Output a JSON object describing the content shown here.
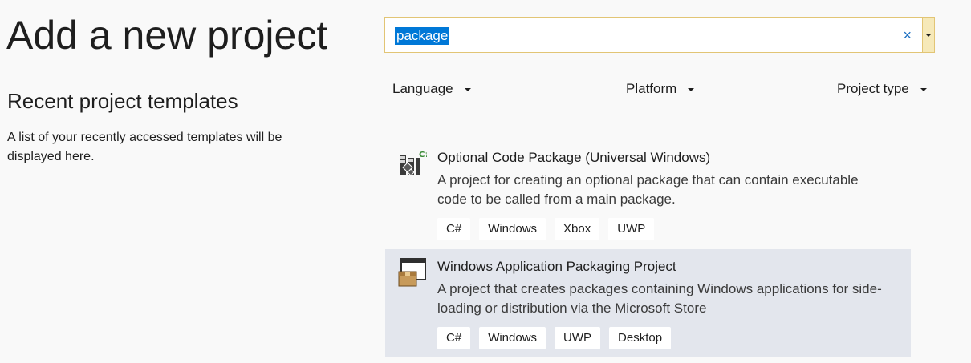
{
  "page": {
    "title": "Add a new project"
  },
  "recent": {
    "heading": "Recent project templates",
    "description": "A list of your recently accessed templates will be displayed here."
  },
  "search": {
    "value": "package",
    "clear_label": "×"
  },
  "filters": [
    {
      "label": "Language"
    },
    {
      "label": "Platform"
    },
    {
      "label": "Project type"
    }
  ],
  "results": [
    {
      "title": "Optional Code Package (Universal Windows)",
      "description": "A project for creating an optional package that can contain executable code to be called from a main package.",
      "tags": [
        "C#",
        "Windows",
        "Xbox",
        "UWP"
      ],
      "icon": "code-package-icon",
      "selected": false
    },
    {
      "title": "Windows Application Packaging Project",
      "description": "A project that creates packages containing Windows applications for side-loading or distribution via the Microsoft Store",
      "tags": [
        "C#",
        "Windows",
        "UWP",
        "Desktop"
      ],
      "icon": "packaging-project-icon",
      "selected": true
    }
  ],
  "colors": {
    "accent": "#0078d7",
    "search_border": "#e2c575",
    "selected_row": "#e3e6ed"
  }
}
